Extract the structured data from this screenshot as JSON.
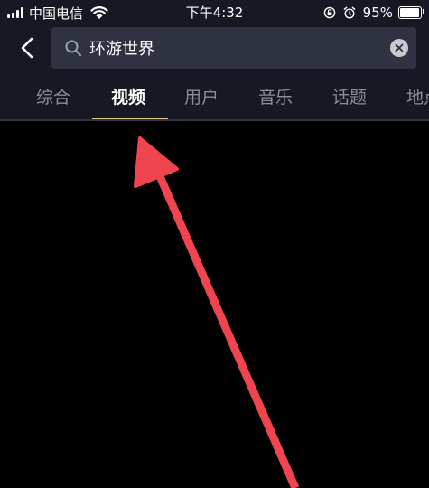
{
  "status_bar": {
    "carrier": "中国电信",
    "time": "下午4:32",
    "battery": "95%",
    "battery_level": 0.95
  },
  "search": {
    "back_icon": "chevron-left-icon",
    "search_icon": "search-icon",
    "query": "环游世界",
    "clear_icon": "clear-icon"
  },
  "tabs": {
    "items": [
      {
        "label": "综合"
      },
      {
        "label": "视频"
      },
      {
        "label": "用户"
      },
      {
        "label": "音乐"
      },
      {
        "label": "话题"
      },
      {
        "label": "地点"
      }
    ],
    "active_index": 1
  },
  "colors": {
    "header_bg": "#161823",
    "search_bg": "#2f3241",
    "tab_inactive": "#8b8d97",
    "tab_indicator": "#e3c68c",
    "annotation_arrow": "#f0454f"
  }
}
